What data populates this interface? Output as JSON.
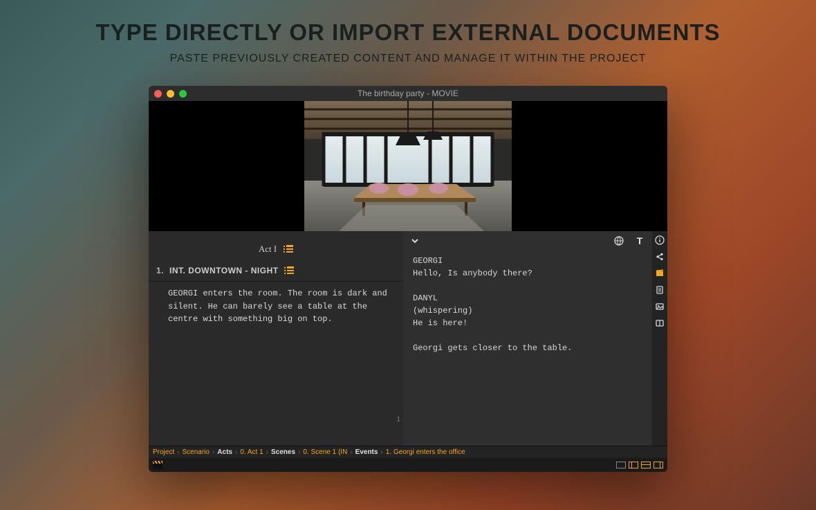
{
  "promo": {
    "title": "TYPE DIRECTLY OR IMPORT EXTERNAL DOCUMENTS",
    "subtitle": "PASTE PREVIOUSLY CREATED CONTENT AND MANAGE IT WITHIN THE PROJECT"
  },
  "window": {
    "title": "The birthday party - MOVIE"
  },
  "left": {
    "act_label": "Act I",
    "scene_number": "1.",
    "scene_title": "INT. DOWNTOWN - NIGHT",
    "scene_body": "GEORGI enters the room. The room is dark and silent. He can barely see a table at the centre with something big on top.",
    "page_number": "1"
  },
  "right": {
    "script": "GEORGI\nHello, Is anybody there?\n\nDANYL\n(whispering)\nHe is here!\n\nGeorgi gets closer to the table."
  },
  "breadcrumb": {
    "items": [
      {
        "label": "Project",
        "active": false
      },
      {
        "label": "Scenario",
        "active": false
      },
      {
        "label": "Acts",
        "active": true
      },
      {
        "label": "0. Act 1",
        "active": false
      },
      {
        "label": "Scenes",
        "active": true
      },
      {
        "label": "0. Scene 1 (IN",
        "active": false
      },
      {
        "label": "Events",
        "active": true
      },
      {
        "label": "1. Georgi enters the office",
        "active": false
      }
    ]
  }
}
